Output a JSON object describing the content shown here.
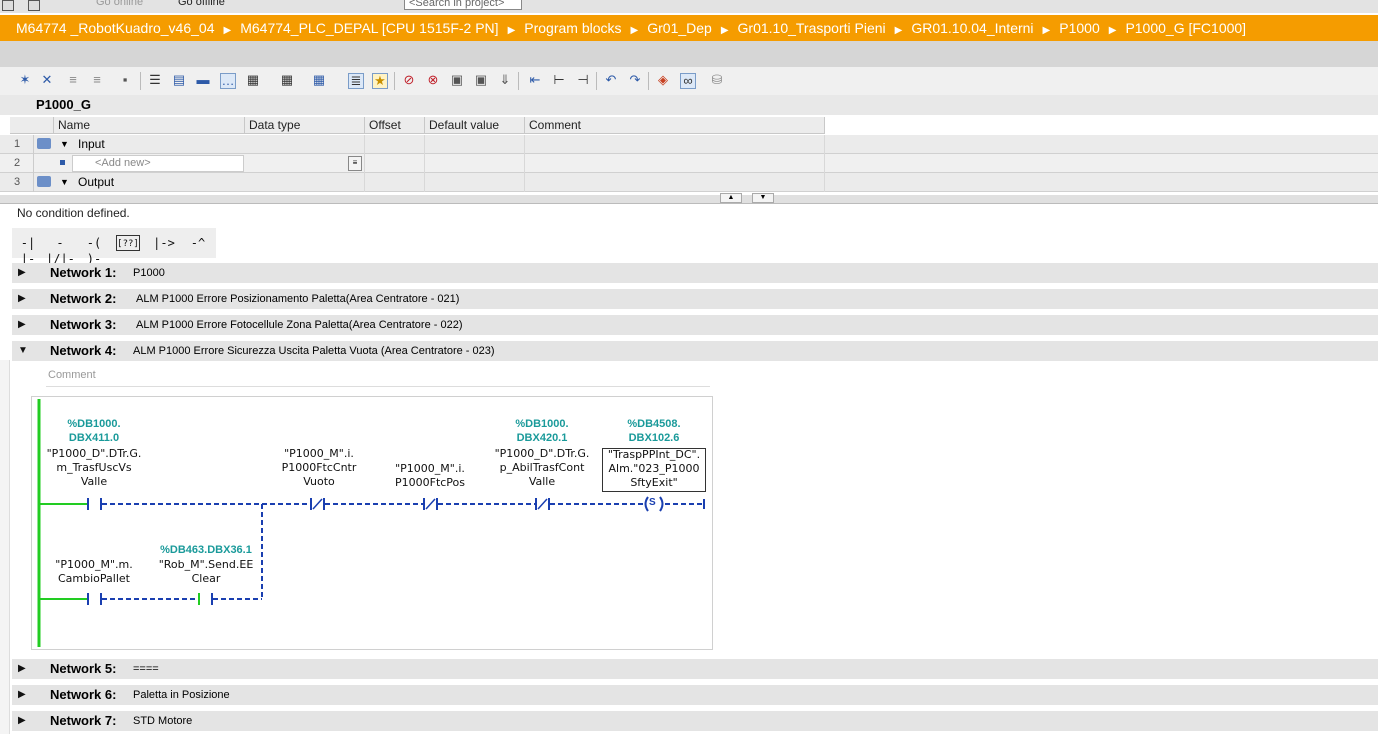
{
  "top_strip": {
    "go_online": "Go online",
    "go_offline": "Go offline",
    "search_placeholder": "<Search in project>"
  },
  "breadcrumb": [
    "M64774 _RobotKuadro_v46_04",
    "M64774_PLC_DEPAL [CPU 1515F-2 PN]",
    "Program blocks",
    "Gr01_Dep",
    "Gr01.10_Trasporti Pieni",
    "GR01.10.04_Interni",
    "P1000",
    "P1000_G [FC1000]"
  ],
  "block_title": "P1000_G",
  "interface": {
    "columns": [
      "Name",
      "Data type",
      "Offset",
      "Default value",
      "Comment"
    ],
    "rows": [
      {
        "num": "1",
        "name": "Input"
      },
      {
        "num": "2",
        "name": "<Add new>"
      },
      {
        "num": "3",
        "name": "Output"
      }
    ]
  },
  "condition_text": "No condition defined.",
  "ladder_tools": [
    "-| |-",
    "-|/|-",
    "-( )-",
    "[??]",
    "|->",
    "-^"
  ],
  "networks_before": [
    {
      "label": "Network 1:",
      "title": "P1000"
    },
    {
      "label": "Network 2:",
      "title": "ALM P1000 Errore Posizionamento Paletta(Area Centratore - 021)"
    },
    {
      "label": "Network 3:",
      "title": "ALM P1000 Errore Fotocellule Zona Paletta(Area Centratore - 022)"
    },
    {
      "label": "Network 4:",
      "title": "ALM P1000 Errore Sicurezza Uscita Paletta Vuota   (Area Centratore - 023)"
    }
  ],
  "network4_comment": "Comment",
  "ladder": {
    "c1": {
      "addr1": "%DB1000.",
      "addr2": "DBX411.0",
      "tag1": "\"P1000_D\".DTr.G.",
      "tag2": "m_TrasfUscVs",
      "tag3": "Valle"
    },
    "c2": {
      "tag1": "\"P1000_M\".i.",
      "tag2": "P1000FtcCntr",
      "tag3": "Vuoto"
    },
    "c3": {
      "tag1": "\"P1000_M\".i.",
      "tag2": "P1000FtcPos"
    },
    "c4": {
      "addr1": "%DB1000.",
      "addr2": "DBX420.1",
      "tag1": "\"P1000_D\".DTr.G.",
      "tag2": "p_AbilTrasfCont",
      "tag3": "Valle"
    },
    "coil": {
      "addr1": "%DB4508.",
      "addr2": "DBX102.6",
      "tag1": "\"TraspPPInt_DC\".",
      "tag2": "Alm.\"023_P1000",
      "tag3": "SftyExit\"",
      "symbol": "S"
    },
    "c5": {
      "tag1": "\"P1000_M\".m.",
      "tag2": "CambioPallet"
    },
    "c6": {
      "addr1": "%DB463.DBX36.1",
      "tag1": "\"Rob_M\".Send.EE",
      "tag2": "Clear"
    }
  },
  "networks_after": [
    {
      "label": "Network 5:",
      "title": "===="
    },
    {
      "label": "Network 6:",
      "title": "Paletta in Posizione"
    },
    {
      "label": "Network 7:",
      "title": "STD Motore"
    }
  ]
}
